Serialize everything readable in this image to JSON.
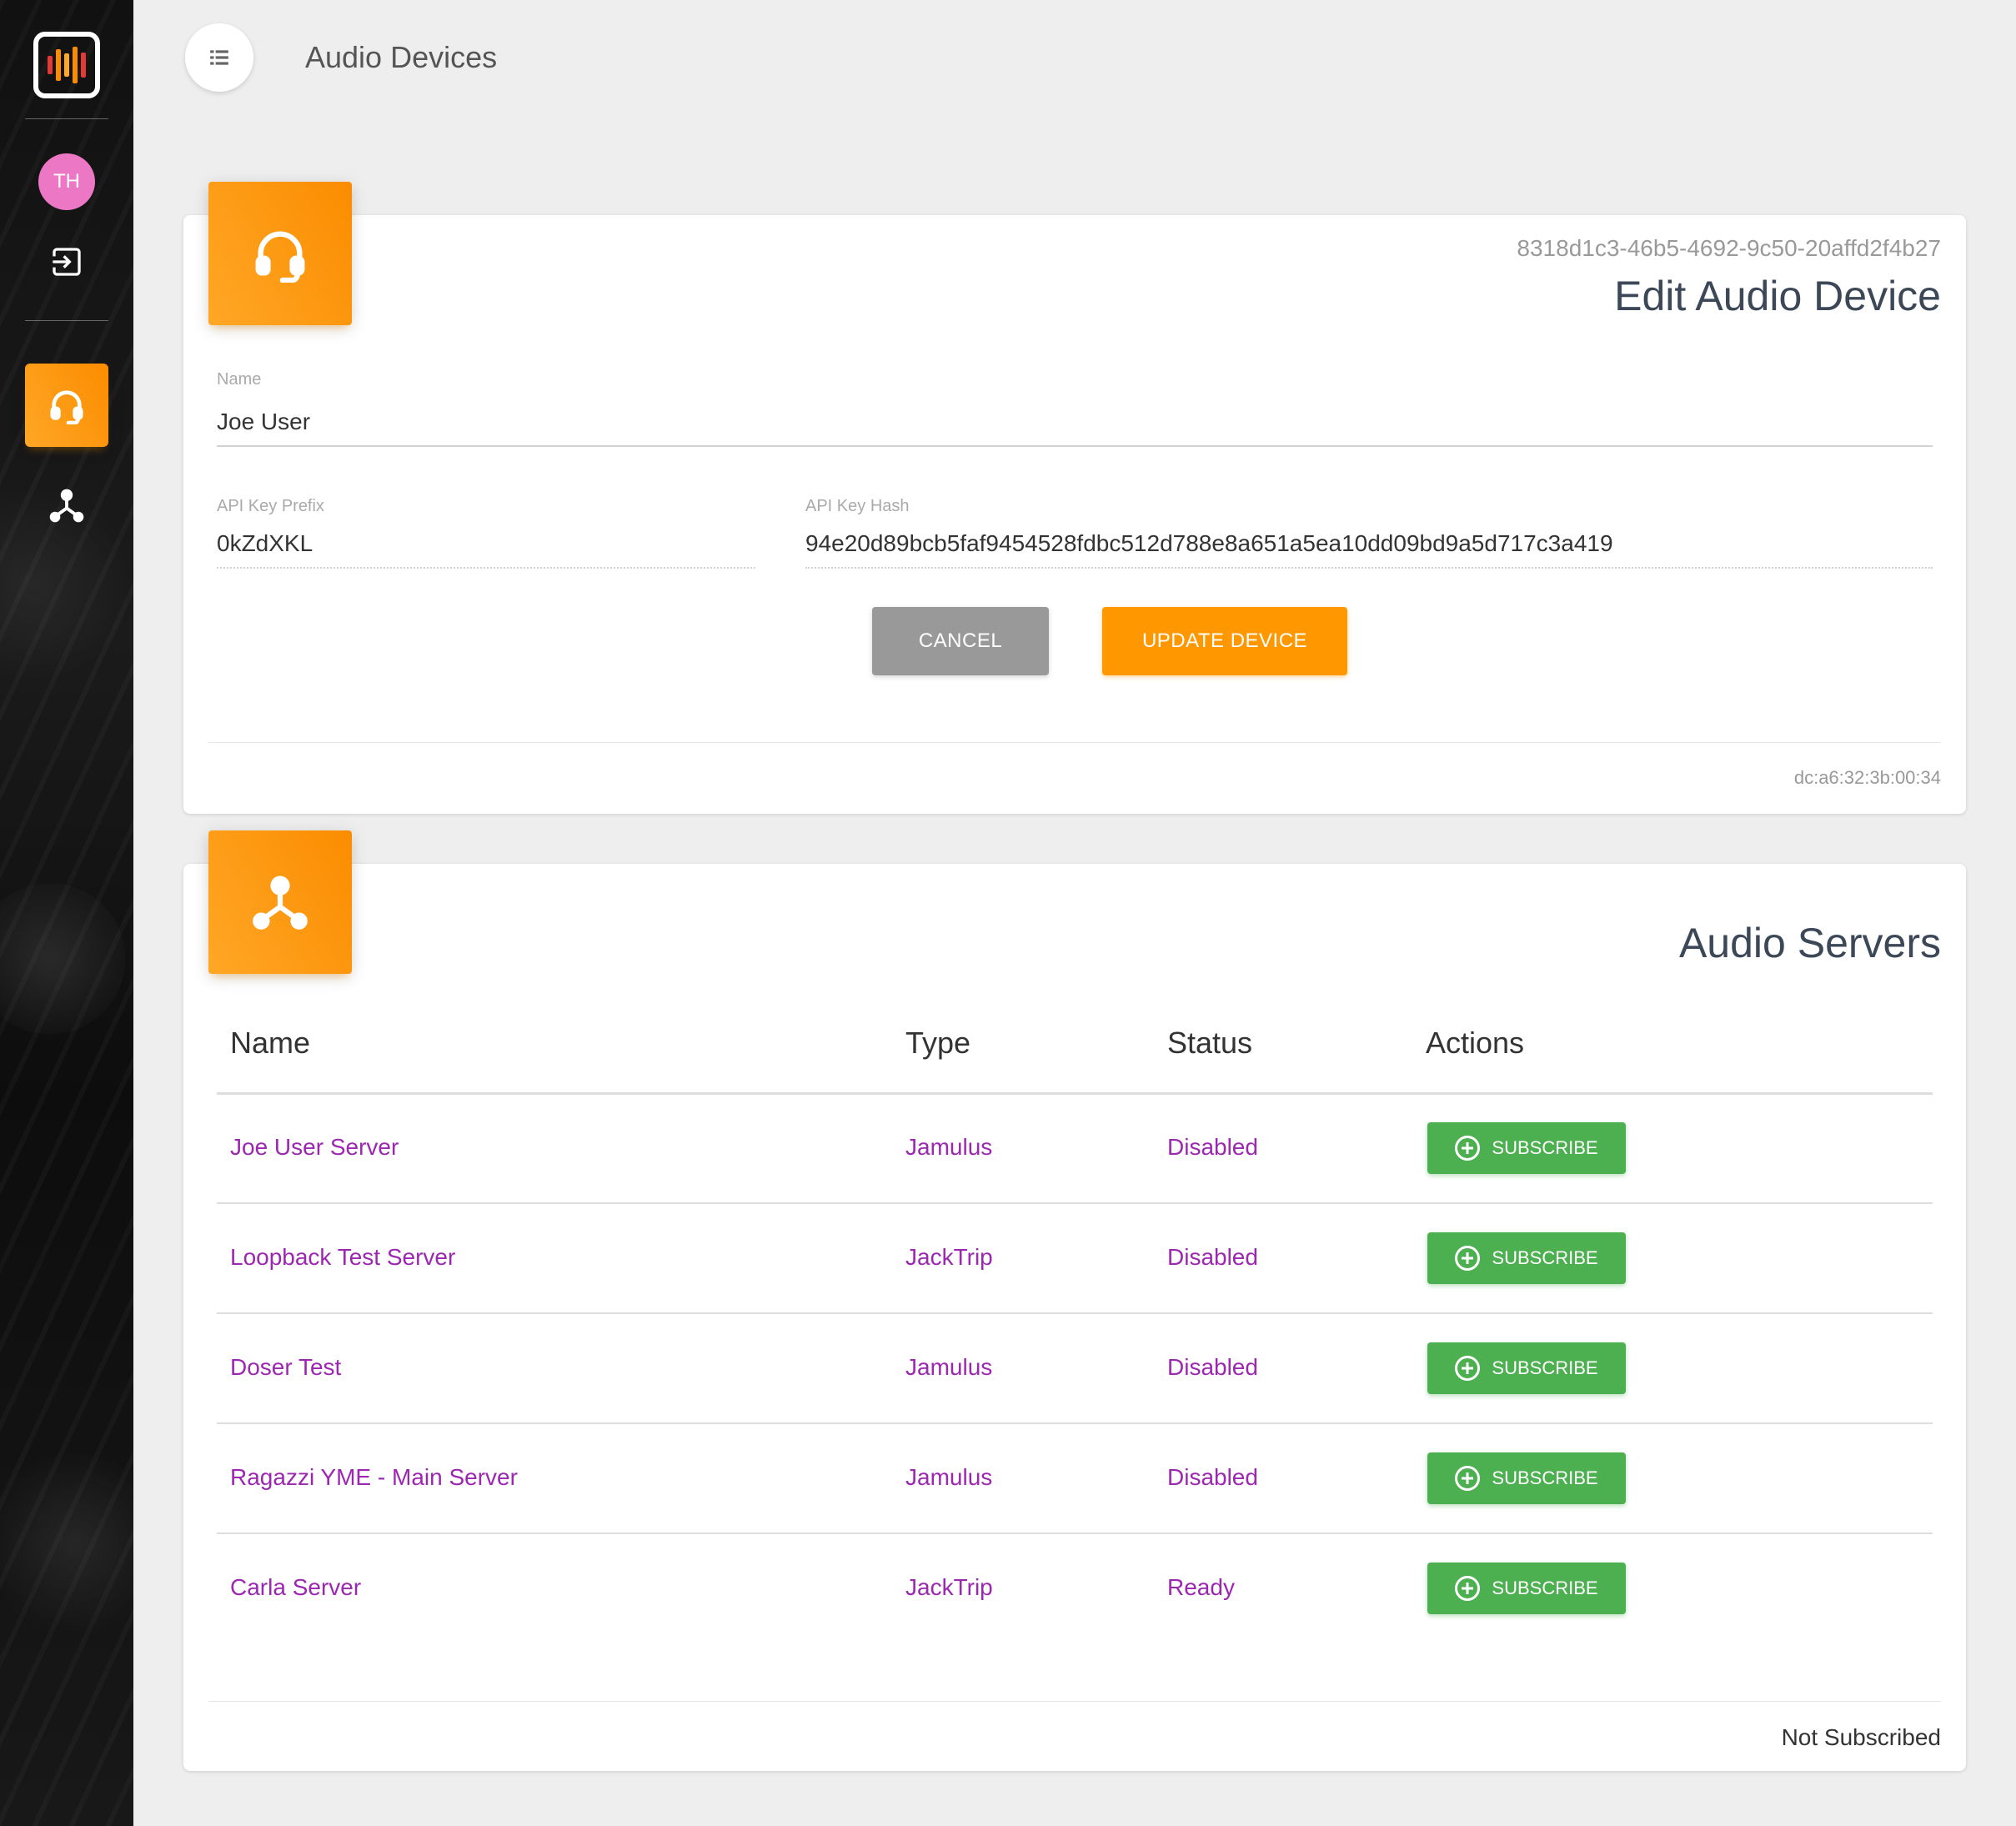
{
  "sidebar": {
    "avatar_initials": "TH",
    "logo_icon": "waveform-logo-icon",
    "items": [
      {
        "icon": "logout-icon"
      },
      {
        "icon": "headset-icon",
        "active": true
      },
      {
        "icon": "network-icon"
      }
    ]
  },
  "header": {
    "title": "Audio Devices",
    "menu_icon": "list-icon"
  },
  "edit_card": {
    "icon": "headset-icon",
    "device_id": "8318d1c3-46b5-4692-9c50-20affd2f4b27",
    "title": "Edit Audio Device",
    "name_label": "Name",
    "name_value": "Joe User",
    "api_prefix_label": "API Key Prefix",
    "api_prefix_value": "0kZdXKL",
    "api_hash_label": "API Key Hash",
    "api_hash_value": "94e20d89bcb5faf9454528fdbc512d788e8a651a5ea10dd09bd9a5d717c3a419",
    "cancel_label": "CANCEL",
    "update_label": "UPDATE DEVICE",
    "footer": "dc:a6:32:3b:00:34"
  },
  "servers_card": {
    "icon": "network-icon",
    "title": "Audio Servers",
    "columns": [
      "Name",
      "Type",
      "Status",
      "Actions"
    ],
    "rows": [
      {
        "name": "Joe User Server",
        "type": "Jamulus",
        "status": "Disabled",
        "action": "SUBSCRIBE"
      },
      {
        "name": "Loopback Test Server",
        "type": "JackTrip",
        "status": "Disabled",
        "action": "SUBSCRIBE"
      },
      {
        "name": "Doser Test",
        "type": "Jamulus",
        "status": "Disabled",
        "action": "SUBSCRIBE"
      },
      {
        "name": "Ragazzi YME - Main Server",
        "type": "Jamulus",
        "status": "Disabled",
        "action": "SUBSCRIBE"
      },
      {
        "name": "Carla Server",
        "type": "JackTrip",
        "status": "Ready",
        "action": "SUBSCRIBE"
      }
    ],
    "footer": "Not Subscribed"
  },
  "colors": {
    "accent": "#ff9800",
    "subscribe": "#4caf50",
    "link": "#9c27b0",
    "cancel": "#999999",
    "avatar": "#ec78c5"
  }
}
